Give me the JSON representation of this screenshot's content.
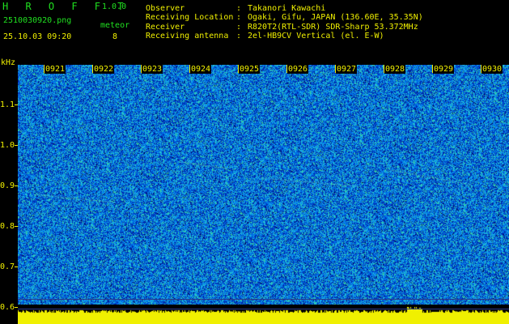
{
  "app": {
    "title": "H R O F F T",
    "version": "1.0.0"
  },
  "file": {
    "name": "2510030920.png",
    "datetime": "25.10.03 09:20"
  },
  "meteor": {
    "label": "meteor",
    "count": "8"
  },
  "info": [
    {
      "key": "Observer",
      "sep": ":",
      "value": "Takanori Kawachi"
    },
    {
      "key": "Receiving Location",
      "sep": ":",
      "value": "Ogaki, Gifu, JAPAN (136.60E, 35.35N)"
    },
    {
      "key": "Receiver",
      "sep": ":",
      "value": "R820T2(RTL-SDR) SDR-Sharp 53.372MHz"
    },
    {
      "key": "Receiving antenna",
      "sep": ":",
      "value": "2el-HB9CV Vertical (el. E-W)"
    }
  ],
  "axis": {
    "unit": "kHz",
    "y_ticks": [
      "1.1",
      "1.0",
      "0.9",
      "0.8",
      "0.7",
      "0.6"
    ],
    "time_labels": [
      "0921",
      "0922",
      "0923",
      "0924",
      "0925",
      "0926",
      "0927",
      "0928",
      "0929",
      "0930"
    ]
  },
  "colors": {
    "green": "#20e020",
    "yellow": "#f0f000",
    "background": "#000000"
  }
}
